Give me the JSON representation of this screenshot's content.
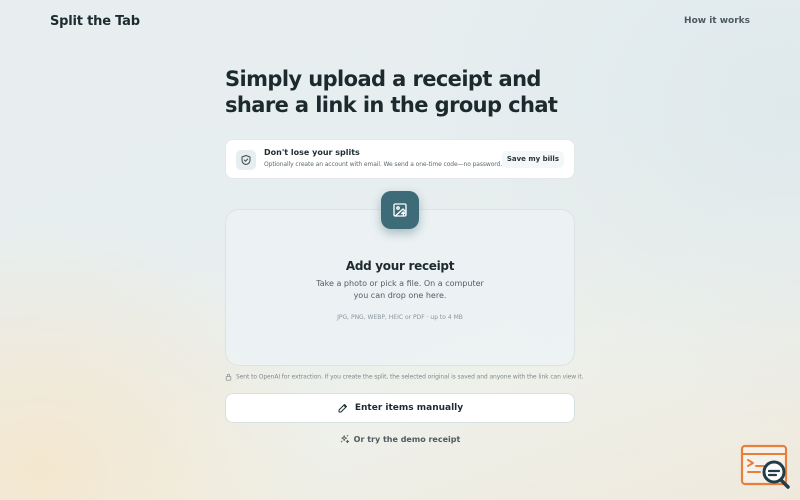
{
  "header": {
    "brand": "Split the Tab",
    "nav_link": "How it works"
  },
  "hero": {
    "line1": "Simply upload a receipt and",
    "line2": "share a link in the group chat"
  },
  "notice": {
    "icon": "shield-check-icon",
    "title": "Don't lose your splits",
    "subtitle": "Optionally create an account with email. We send a one-time code—no password.",
    "button": "Save my bills"
  },
  "upload": {
    "icon": "image-upload-icon",
    "title": "Add your receipt",
    "description": "Take a photo or pick a file. On a computer you can drop one here.",
    "formats": "JPG, PNG, WEBP, HEIC or PDF · up to 4 MB"
  },
  "privacy_note": {
    "icon": "lock-icon",
    "text": "Sent to OpenAI for extraction. If you create the split, the selected original is saved and anyone with the link can view it."
  },
  "manual_entry": {
    "icon": "pencil-icon",
    "label": "Enter items manually"
  },
  "demo": {
    "icon": "sparkles-icon",
    "label": "Or try the demo receipt"
  },
  "colors": {
    "accent": "#3e6b78",
    "corner_logo": "#e8803a"
  }
}
